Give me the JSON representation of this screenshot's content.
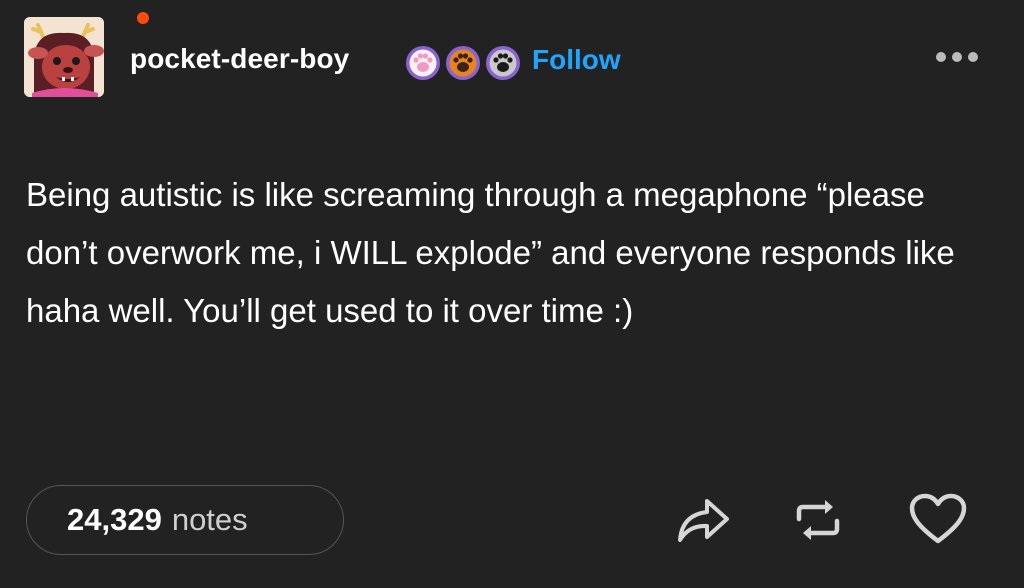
{
  "post": {
    "username": "pocket-deer-boy",
    "follow_label": "Follow",
    "body": "Being autistic is like screaming through a megaphone “please don’t overwork me, i WILL explode” and everyone responds like haha well. You’ll get used to it over time :)",
    "badges": [
      "paw-badge-pink",
      "paw-badge-orange",
      "paw-badge-gray"
    ],
    "notes_count": "24,329",
    "notes_label": "notes",
    "online": true
  },
  "colors": {
    "background": "#222222",
    "follow": "#1ea5ff",
    "online_dot": "#ff4a0e",
    "text": "#ffffff",
    "muted": "#cfcfcf"
  },
  "icons": {
    "share": "share-arrow-icon",
    "reblog": "reblog-icon",
    "like": "heart-icon",
    "more": "more-options-icon"
  }
}
